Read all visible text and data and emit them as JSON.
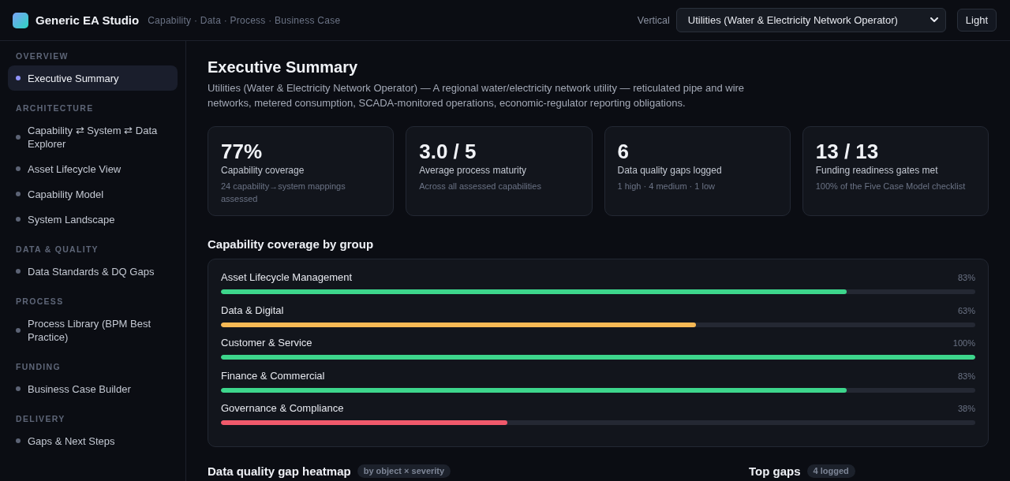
{
  "app": {
    "title": "Generic EA Studio",
    "subtitle": "Capability · Data · Process · Business Case"
  },
  "vertical": {
    "label": "Vertical",
    "value": "Utilities (Water & Electricity Network Operator)"
  },
  "theme_button": "Light",
  "sidebar": {
    "sections": [
      {
        "heading": "OVERVIEW",
        "items": [
          {
            "label": "Executive Summary",
            "selected": true
          }
        ]
      },
      {
        "heading": "ARCHITECTURE",
        "items": [
          {
            "label": "Capability ⇄ System ⇄ Data Explorer",
            "selected": false
          },
          {
            "label": "Asset Lifecycle View",
            "selected": false
          },
          {
            "label": "Capability Model",
            "selected": false
          },
          {
            "label": "System Landscape",
            "selected": false
          }
        ]
      },
      {
        "heading": "DATA & QUALITY",
        "items": [
          {
            "label": "Data Standards & DQ Gaps",
            "selected": false
          }
        ]
      },
      {
        "heading": "PROCESS",
        "items": [
          {
            "label": "Process Library (BPM Best Practice)",
            "selected": false
          }
        ]
      },
      {
        "heading": "FUNDING",
        "items": [
          {
            "label": "Business Case Builder",
            "selected": false
          }
        ]
      },
      {
        "heading": "DELIVERY",
        "items": [
          {
            "label": "Gaps & Next Steps",
            "selected": false
          }
        ]
      }
    ]
  },
  "page": {
    "title": "Executive Summary",
    "description": "Utilities (Water & Electricity Network Operator) — A regional water/electricity network utility — reticulated pipe and wire networks, metered consumption, SCADA-monitored operations, economic-regulator reporting obligations."
  },
  "stats": [
    {
      "value": "77%",
      "label": "Capability coverage",
      "note": "24 capability→system mappings assessed"
    },
    {
      "value": "3.0 / 5",
      "label": "Average process maturity",
      "note": "Across all assessed capabilities"
    },
    {
      "value": "6",
      "label": "Data quality gaps logged",
      "note": "1 high · 4 medium · 1 low"
    },
    {
      "value": "13 / 13",
      "label": "Funding readiness gates met",
      "note": "100% of the Five Case Model checklist"
    }
  ],
  "coverage": {
    "title": "Capability coverage by group",
    "groups": [
      {
        "name": "Asset Lifecycle Management",
        "level": 0.83,
        "reading": "83%"
      },
      {
        "name": "Data & Digital",
        "level": 0.63,
        "reading": "63%"
      },
      {
        "name": "Customer & Service",
        "level": 1,
        "reading": "100%"
      },
      {
        "name": "Finance & Commercial",
        "level": 0.83,
        "reading": "83%"
      },
      {
        "name": "Governance & Compliance",
        "level": 0.38,
        "reading": "38%"
      }
    ]
  },
  "heatmap": {
    "title": "Data quality gap heatmap",
    "badge": "by object × severity"
  },
  "top_gaps": {
    "title": "Top gaps",
    "badge": "4 logged"
  }
}
